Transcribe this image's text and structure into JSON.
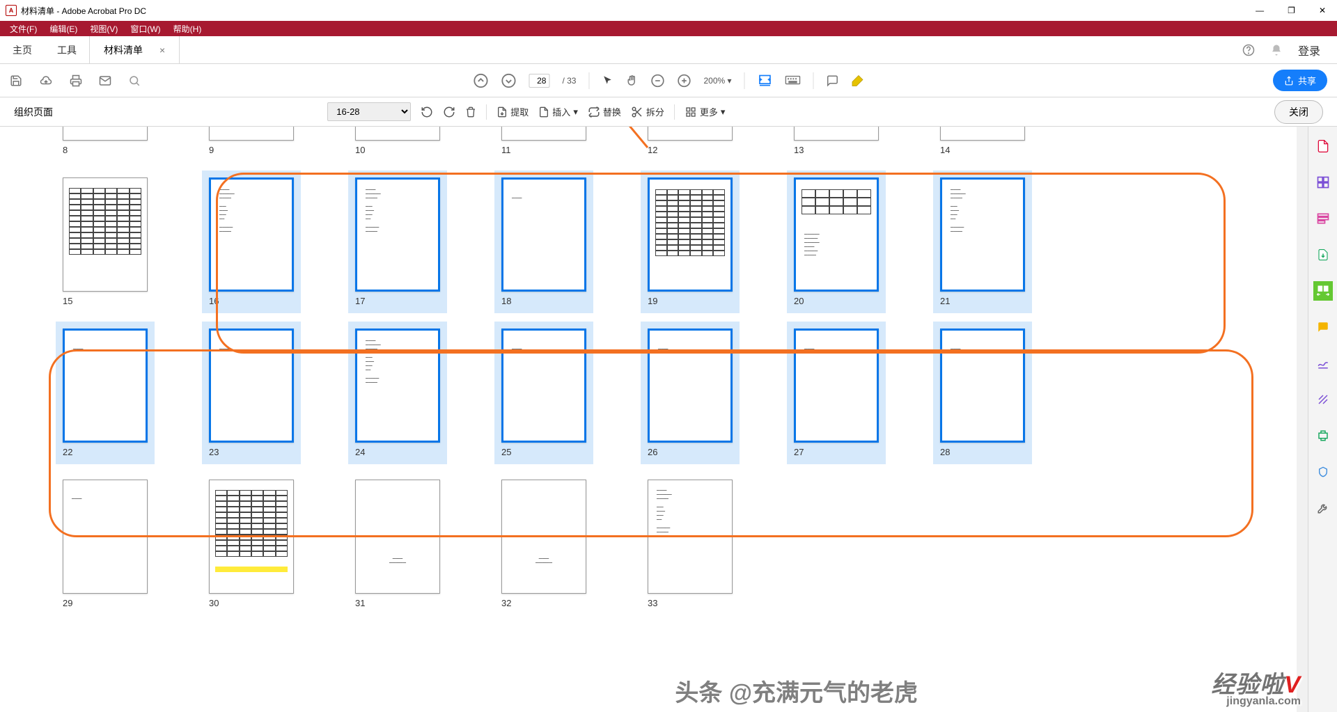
{
  "title": "材料清单 - Adobe Acrobat Pro DC",
  "app_icon_letter": "A",
  "menu": {
    "file": "文件(F)",
    "edit": "编辑(E)",
    "view": "视图(V)",
    "window": "窗口(W)",
    "help": "帮助(H)"
  },
  "tabs": {
    "home": "主页",
    "tools": "工具",
    "doc": "材料清单",
    "close": "×",
    "login": "登录"
  },
  "toolbar": {
    "page_current": "28",
    "page_total": "/ 33",
    "zoom": "200%",
    "share": "共享"
  },
  "secondary": {
    "title": "组织页面",
    "range": "16-28",
    "extract": "提取",
    "insert": "插入",
    "replace": "替换",
    "split": "拆分",
    "more": "更多",
    "close": "关闭"
  },
  "pages_row1": [
    8,
    9,
    10,
    11,
    12,
    13,
    14
  ],
  "pages_row2": [
    15,
    16,
    17,
    18,
    19,
    20,
    21
  ],
  "pages_row3": [
    22,
    23,
    24,
    25,
    26,
    27,
    28
  ],
  "pages_row4": [
    29,
    30,
    31,
    32,
    33
  ],
  "selected": [
    16,
    17,
    18,
    19,
    20,
    21,
    22,
    23,
    24,
    25,
    26,
    27,
    28
  ],
  "watermark": {
    "toutiao": "头条 @充满元气的老虎",
    "brand": "经验啦",
    "v": "V",
    "url": "jingyanla.com"
  }
}
